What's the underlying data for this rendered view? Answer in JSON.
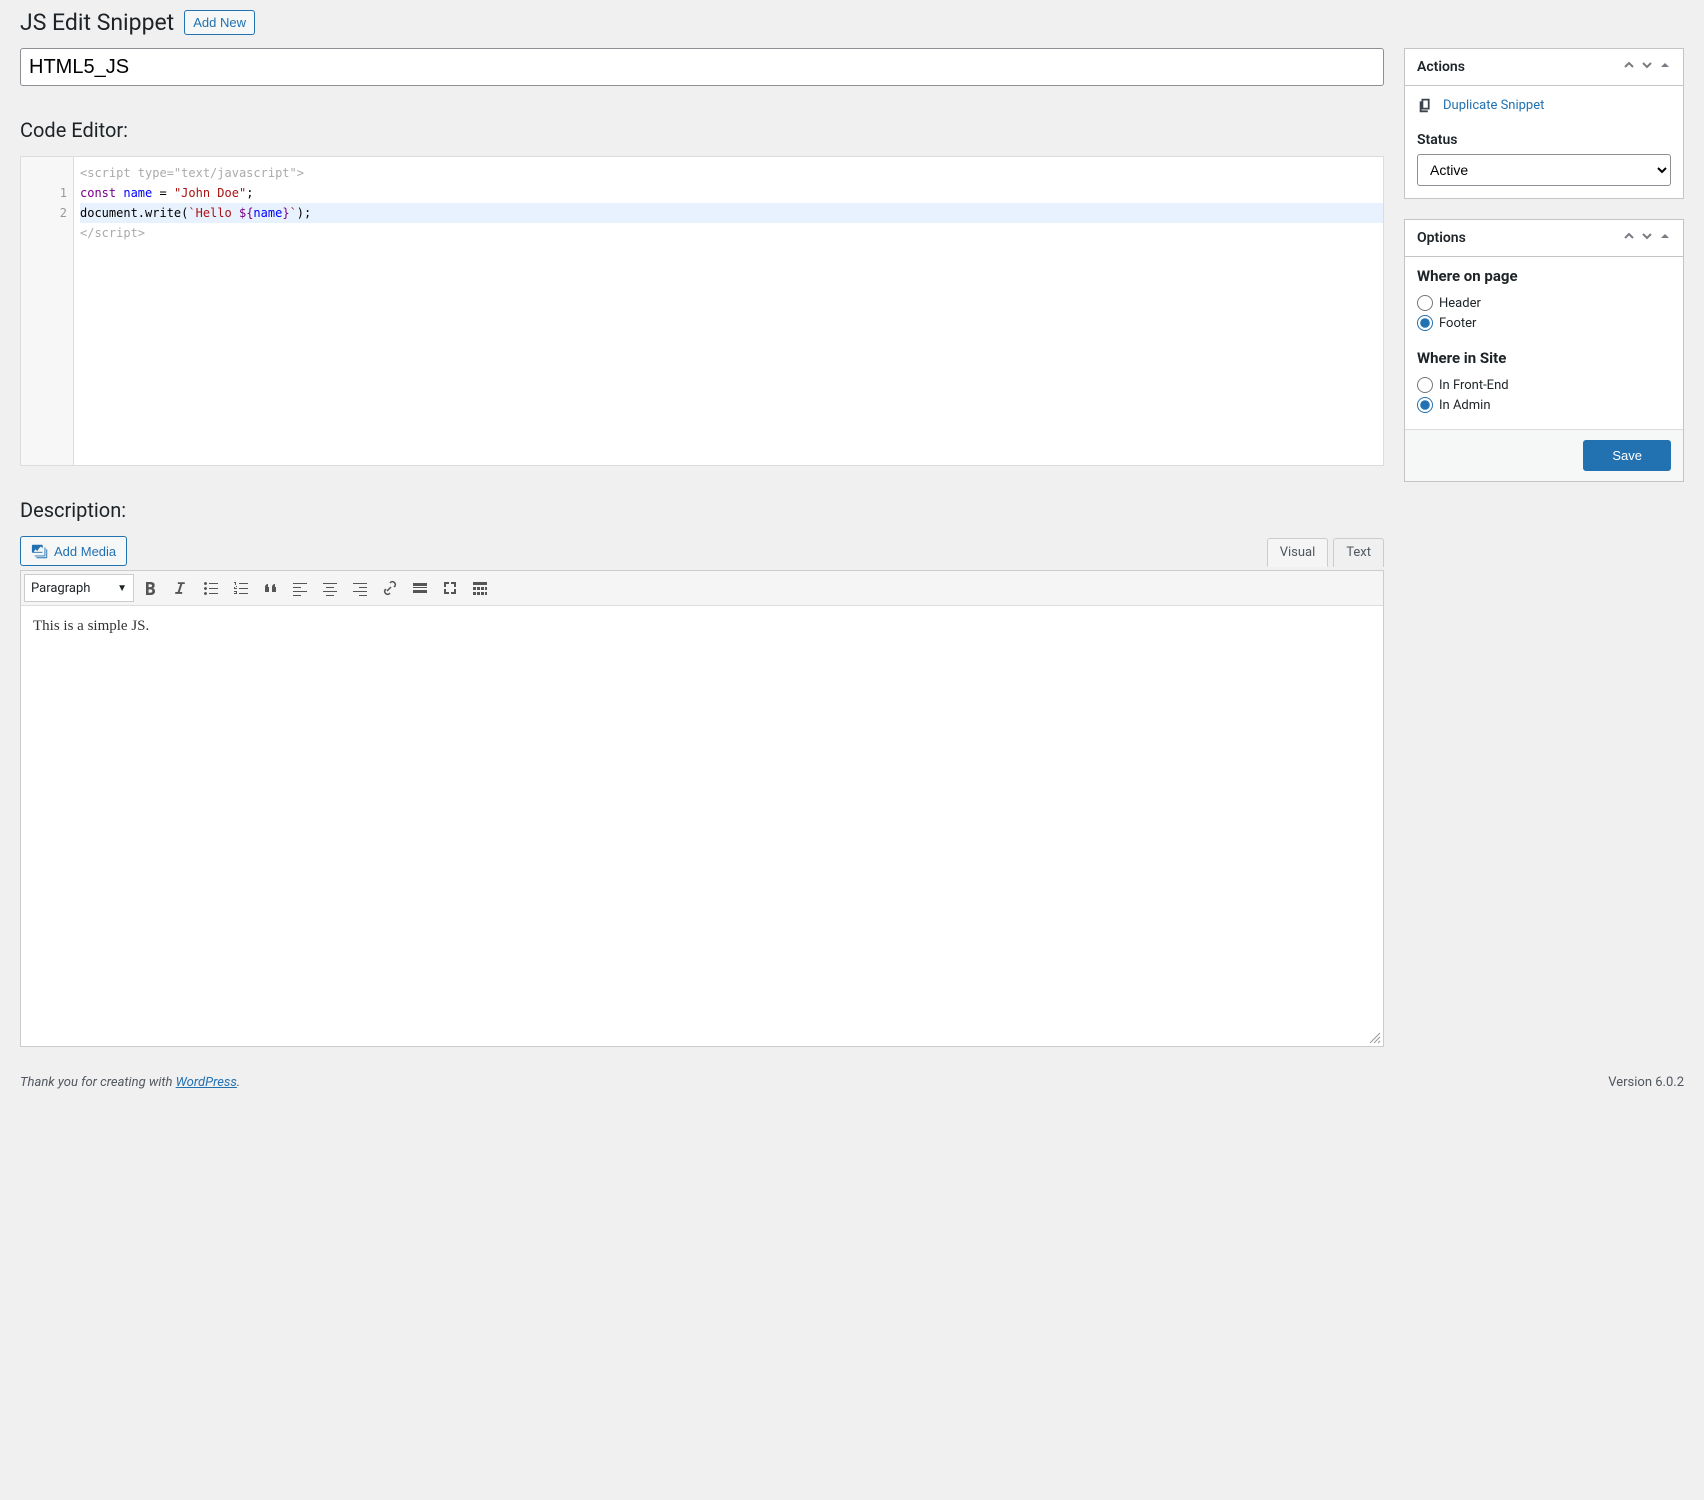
{
  "header": {
    "page_title": "JS Edit Snippet",
    "add_new_label": "Add New"
  },
  "title_input_value": "HTML5_JS",
  "code_editor": {
    "heading": "Code Editor:",
    "open_tag": "<script type=\"text/javascript\">",
    "close_tag": "</script>",
    "line1_keyword": "const",
    "line1_var": "name",
    "line1_eq": " = ",
    "line1_string": "\"John Doe\"",
    "line1_semi": ";",
    "line2_obj": "document.write(",
    "line2_tick1": "`",
    "line2_str": "Hello ",
    "line2_interp_open": "${",
    "line2_interp_var": "name",
    "line2_interp_close": "}",
    "line2_tick2": "`",
    "line2_close": ");",
    "line_numbers": [
      "1",
      "2"
    ]
  },
  "description": {
    "heading": "Description:",
    "add_media_label": "Add Media",
    "tabs": {
      "visual": "Visual",
      "text": "Text"
    },
    "format_select": "Paragraph",
    "content": "This is a simple JS."
  },
  "sidebar": {
    "actions": {
      "title": "Actions",
      "duplicate_label": "Duplicate Snippet",
      "status_label": "Status",
      "status_value": "Active"
    },
    "options": {
      "title": "Options",
      "where_page_heading": "Where on page",
      "header_label": "Header",
      "footer_label": "Footer",
      "where_site_heading": "Where in Site",
      "frontend_label": "In Front-End",
      "admin_label": "In Admin",
      "save_label": "Save"
    }
  },
  "footer": {
    "thanks_prefix": "Thank you for creating with ",
    "wordpress_label": "WordPress",
    "period": ".",
    "version": "Version 6.0.2"
  }
}
